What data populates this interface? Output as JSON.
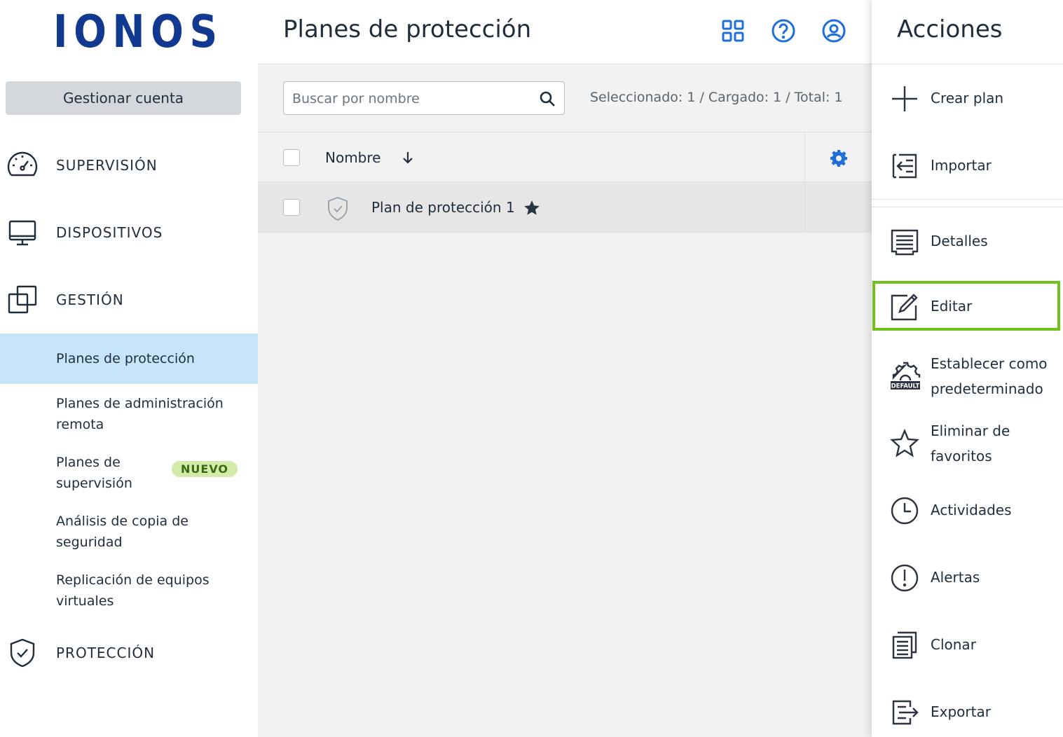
{
  "logo": {
    "text": "IONOS"
  },
  "sidebar": {
    "manage_label": "Gestionar cuenta",
    "sections": [
      {
        "label": "SUPERVISIÓN",
        "icon": "speedometer-icon"
      },
      {
        "label": "DISPOSITIVOS",
        "icon": "monitor-icon"
      },
      {
        "label": "GESTIÓN",
        "icon": "layers-icon"
      },
      {
        "label": "PROTECCIÓN",
        "icon": "shield-check-icon"
      }
    ],
    "sub_items": [
      {
        "label": "Planes de protección",
        "active": true
      },
      {
        "label": "Planes de administración remota"
      },
      {
        "label": "Planes de supervisión",
        "badge": "NUEVO"
      },
      {
        "label": "Análisis de copia de seguridad"
      },
      {
        "label": "Replicación de equipos virtuales"
      }
    ]
  },
  "header": {
    "title": "Planes de protección",
    "icons": [
      "grid-icon",
      "help-icon",
      "account-icon"
    ]
  },
  "toolbar": {
    "search_placeholder": "Buscar por nombre",
    "counts": "Seleccionado: 1 / Cargado: 1 / Total: 1"
  },
  "table": {
    "columns": [
      {
        "label": "Nombre",
        "sort": "descending"
      }
    ],
    "rows": [
      {
        "name": "Plan de protección 1",
        "favorite": true
      }
    ]
  },
  "actions": {
    "title": "Acciones",
    "items": [
      {
        "label": "Crear plan",
        "icon": "plus-icon"
      },
      {
        "label": "Importar",
        "icon": "import-icon"
      },
      {
        "label": "Detalles",
        "icon": "details-icon"
      },
      {
        "label": "Editar",
        "icon": "edit-icon",
        "highlighted": true
      },
      {
        "label": "Establecer como predeterminado",
        "icon": "default-gear-icon",
        "icon_text": "DEFAULT"
      },
      {
        "label": "Eliminar de favoritos",
        "icon": "star-outline-icon"
      },
      {
        "label": "Actividades",
        "icon": "clock-icon"
      },
      {
        "label": "Alertas",
        "icon": "alert-icon"
      },
      {
        "label": "Clonar",
        "icon": "clone-icon"
      },
      {
        "label": "Exportar",
        "icon": "export-icon"
      }
    ]
  },
  "colors": {
    "brand": "#11398f",
    "accent_blue": "#1e6fd9",
    "active_bg": "#c7e5f8",
    "highlight_green": "#6fc21b",
    "badge_bg": "#d3ebaa"
  }
}
